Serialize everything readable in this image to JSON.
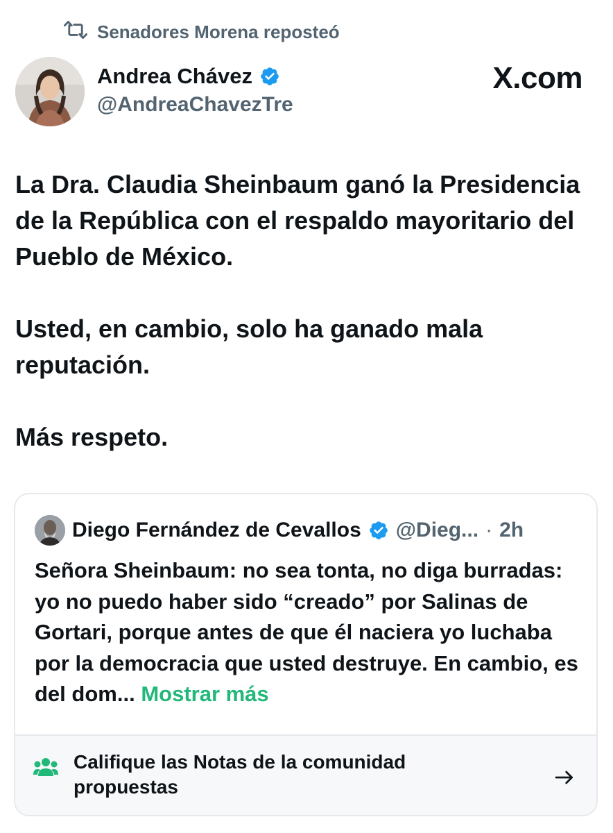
{
  "repost": {
    "icon": "repost-icon",
    "text": "Senadores Morena reposteó"
  },
  "author": {
    "name": "Andrea Chávez",
    "handle": "@AndreaChavezTre",
    "verified": true
  },
  "brand": "X.com",
  "tweet": {
    "paragraphs": [
      "La Dra. Claudia Sheinbaum ganó la Presidencia de la República con el respaldo mayoritario del Pueblo de México.",
      "Usted, en cambio, solo ha ganado mala reputación.",
      "Más respeto."
    ]
  },
  "quote": {
    "author_name": "Diego Fernández de Cevallos",
    "handle": "@Dieg...",
    "separator": "·",
    "time": "2h",
    "text": "Señora Sheinbaum: no sea tonta, no diga burradas: yo no puedo haber sido “creado” por Salinas de Gortari, porque antes de que él naciera yo luchaba por la democracia que usted destruye. En cambio, es del dom...",
    "show_more": "Mostrar más"
  },
  "community_notes": {
    "text": "Califique las Notas de la comunidad propuestas",
    "icon": "community-icon",
    "arrow": "arrow-right-icon"
  },
  "colors": {
    "text": "#0f1419",
    "secondary": "#536471",
    "verified": "#1d9bf0",
    "show_more": "#22b87a",
    "community_icon": "#22b87a",
    "border": "#e6e9ec"
  }
}
